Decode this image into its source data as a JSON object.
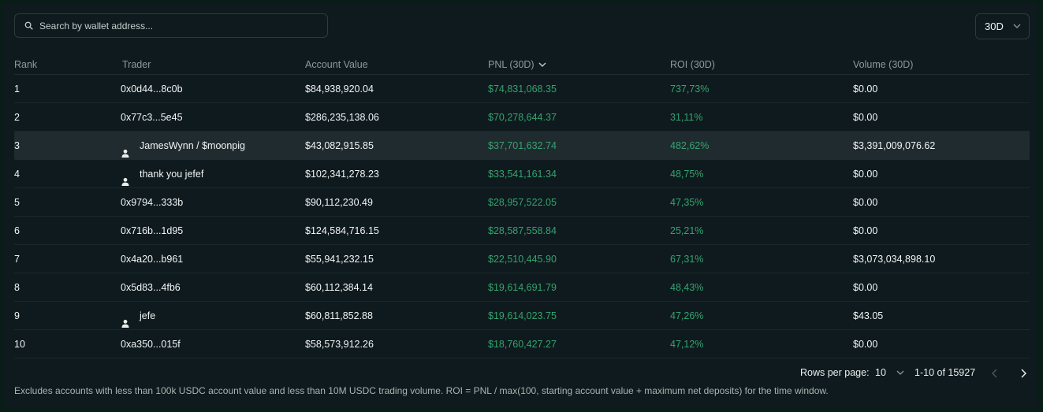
{
  "search": {
    "placeholder": "Search by wallet address..."
  },
  "period": {
    "value": "30D"
  },
  "columns": [
    "Rank",
    "Trader",
    "Account Value",
    "PNL (30D)",
    "ROI (30D)",
    "Volume (30D)"
  ],
  "rows": [
    {
      "rank": "1",
      "trader": "0x0d44...8c0b",
      "user": false,
      "account": "$84,938,920.04",
      "pnl": "$74,831,068.35",
      "roi": "737,73%",
      "volume": "$0.00"
    },
    {
      "rank": "2",
      "trader": "0x77c3...5e45",
      "user": false,
      "account": "$286,235,138.06",
      "pnl": "$70,278,644.37",
      "roi": "31,11%",
      "volume": "$0.00"
    },
    {
      "rank": "3",
      "trader": "JamesWynn / $moonpig",
      "user": true,
      "account": "$43,082,915.85",
      "pnl": "$37,701,632.74",
      "roi": "482,62%",
      "volume": "$3,391,009,076.62",
      "highlighted": true
    },
    {
      "rank": "4",
      "trader": "thank you jefef",
      "user": true,
      "account": "$102,341,278.23",
      "pnl": "$33,541,161.34",
      "roi": "48,75%",
      "volume": "$0.00"
    },
    {
      "rank": "5",
      "trader": "0x9794...333b",
      "user": false,
      "account": "$90,112,230.49",
      "pnl": "$28,957,522.05",
      "roi": "47,35%",
      "volume": "$0.00"
    },
    {
      "rank": "6",
      "trader": "0x716b...1d95",
      "user": false,
      "account": "$124,584,716.15",
      "pnl": "$28,587,558.84",
      "roi": "25,21%",
      "volume": "$0.00"
    },
    {
      "rank": "7",
      "trader": "0x4a20...b961",
      "user": false,
      "account": "$55,941,232.15",
      "pnl": "$22,510,445.90",
      "roi": "67,31%",
      "volume": "$3,073,034,898.10"
    },
    {
      "rank": "8",
      "trader": "0x5d83...4fb6",
      "user": false,
      "account": "$60,112,384.14",
      "pnl": "$19,614,691.79",
      "roi": "48,43%",
      "volume": "$0.00"
    },
    {
      "rank": "9",
      "trader": "jefe",
      "user": true,
      "account": "$60,811,852.88",
      "pnl": "$19,614,023.75",
      "roi": "47,26%",
      "volume": "$43.05"
    },
    {
      "rank": "10",
      "trader": "0xa350...015f",
      "user": false,
      "account": "$58,573,912.26",
      "pnl": "$18,760,427.27",
      "roi": "47,12%",
      "volume": "$0.00"
    }
  ],
  "pagination": {
    "rows_per_page_label": "Rows per page:",
    "rows_per_page": "10",
    "range": "1-10 of 15927"
  },
  "footnote": "Excludes accounts with less than 100k USDC account value and less than 10M USDC trading volume. ROI = PNL / max(100, starting account value + maximum net deposits) for the time window.",
  "colors": {
    "positive": "#34a36e",
    "background": "#0f1a1e",
    "highlight_row": "#202b2f"
  },
  "icons": [
    "search-icon",
    "chevron-down-icon",
    "user-icon",
    "chevron-left-icon",
    "chevron-right-icon"
  ]
}
